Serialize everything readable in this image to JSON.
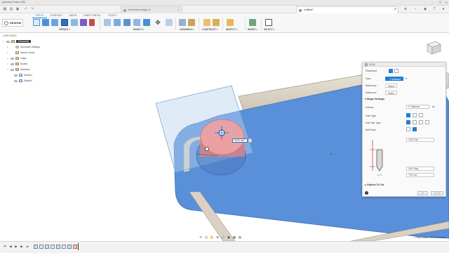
{
  "app": {
    "title": "Autodesk Fusion 360",
    "window_controls": [
      "—",
      "❐",
      "✕"
    ]
  },
  "tabs": [
    {
      "label": "ben/bedm badge v1",
      "active": false
    },
    {
      "label": "Untitled*",
      "active": true
    }
  ],
  "workspace": {
    "selector_label": "DESIGN",
    "tabs": [
      "SOLID",
      "SURFACE",
      "MESH",
      "SHEET METAL",
      "TOOLS"
    ],
    "active_tab": "SOLID",
    "groups": [
      "CREATE ▾",
      "MODIFY ▾",
      "ASSEMBLE ▾",
      "CONSTRUCT ▾",
      "INSPECT ▾",
      "INSERT ▾",
      "SELECT ▾"
    ]
  },
  "browser": {
    "header": "BROWSER",
    "root": "(Unsaved)",
    "items": [
      {
        "label": "Document Settings",
        "indent": 1
      },
      {
        "label": "Named Views",
        "indent": 1
      },
      {
        "label": "Origin",
        "indent": 1
      },
      {
        "label": "Bodies",
        "indent": 1
      },
      {
        "label": "Sketches",
        "indent": 1
      },
      {
        "label": "Sketch1",
        "indent": 2
      },
      {
        "label": "Sketch2",
        "indent": 2
      }
    ]
  },
  "viewport": {
    "dimension_input": "15.00 mm",
    "table_color": "#5a8fd9",
    "rail_color": "#ddd6c9"
  },
  "hole_dialog": {
    "title": "HOLE",
    "placement_label": "Placement",
    "face_label": "Face",
    "face_value": "1 selected",
    "reference_label_1": "Reference",
    "reference_value_1": "Select",
    "reference_label_2": "Reference",
    "reference_value_2": "Select",
    "shape_settings_label": "Shape Settings",
    "extents_label": "Extents",
    "extents_value": "Distance",
    "hole_type_label": "Hole Type",
    "hole_tap_type_label": "Hole Tap Type",
    "drill_point_label": "Drill Point",
    "depth_value": "15.00 mm",
    "angle_value": "118.0 deg",
    "diameter_value": "7.00 mm",
    "objects_to_cut_label": "Objects To Cut",
    "ok_label": "OK",
    "cancel_label": "Cancel"
  },
  "status": {
    "text": "1 Face | Area : 1240.402 mm^2"
  },
  "timeline": {
    "controls": [
      "⏮",
      "◀",
      "▶",
      "▶",
      "⏭"
    ]
  }
}
